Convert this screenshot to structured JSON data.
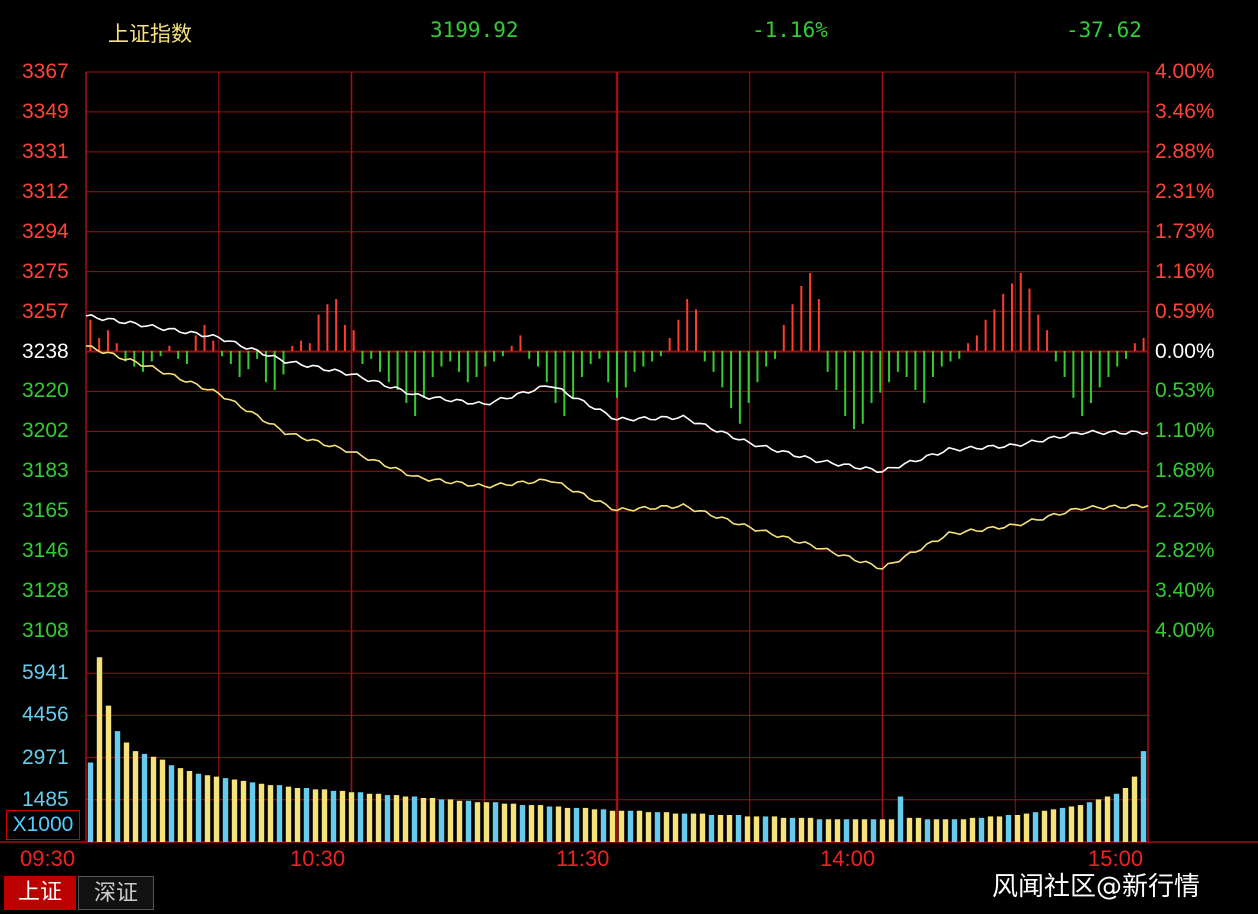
{
  "header": {
    "index_name": "上证指数",
    "last_price": "3199.92",
    "change_pct": "-1.16%",
    "change_pts": "-37.62"
  },
  "colors": {
    "up": "#ff3b30",
    "down": "#33cc33",
    "grid": "#a01010",
    "price_line": "#ffffff",
    "avg_line": "#f5e27a",
    "vol_a": "#f5e27a",
    "vol_b": "#66ccee"
  },
  "y_left_labels": [
    "3367",
    "3349",
    "3331",
    "3312",
    "3294",
    "3275",
    "3257",
    "3238",
    "3220",
    "3202",
    "3183",
    "3165",
    "3146",
    "3128",
    "3108"
  ],
  "y_right_labels": [
    "4.00%",
    "3.46%",
    "2.88%",
    "2.31%",
    "1.73%",
    "1.16%",
    "0.59%",
    "0.00%",
    "0.53%",
    "1.10%",
    "1.68%",
    "2.25%",
    "2.82%",
    "3.40%",
    "4.00%"
  ],
  "vol_labels": [
    "5941",
    "4456",
    "2971",
    "1485"
  ],
  "vol_unit": "X1000",
  "x_labels": [
    "09:30",
    "10:30",
    "11:30",
    "14:00",
    "15:00"
  ],
  "tabs": [
    {
      "label": "上证",
      "active": true
    },
    {
      "label": "深证",
      "active": false
    }
  ],
  "watermark": "风闻社区@新行情",
  "chart_data": {
    "type": "line",
    "x": [
      "09:30",
      "09:45",
      "10:00",
      "10:15",
      "10:30",
      "10:45",
      "11:00",
      "11:15",
      "11:30",
      "13:15",
      "13:30",
      "13:45",
      "14:00",
      "14:15",
      "14:30",
      "14:45",
      "15:00"
    ],
    "prev_close": 3238,
    "ylim": [
      3108,
      3367
    ],
    "series": [
      {
        "values": [
          3254,
          3249,
          3244,
          3233,
          3227,
          3217,
          3213,
          3222,
          3206,
          3207,
          3195,
          3187,
          3182,
          3192,
          3194,
          3200,
          3199.92
        ]
      },
      {
        "values": [
          3240,
          3230,
          3218,
          3200,
          3191,
          3179,
          3175,
          3178,
          3164,
          3166,
          3156,
          3147,
          3137,
          3153,
          3157,
          3165,
          3166
        ]
      }
    ],
    "volume_ylim": [
      0,
      7426
    ],
    "volume_bars": [
      2800,
      6500,
      4800,
      3900,
      3500,
      3200,
      3100,
      3000,
      2900,
      2700,
      2600,
      2500,
      2400,
      2350,
      2300,
      2250,
      2200,
      2150,
      2100,
      2050,
      2000,
      2000,
      1950,
      1900,
      1900,
      1850,
      1850,
      1800,
      1800,
      1750,
      1750,
      1700,
      1700,
      1650,
      1650,
      1600,
      1600,
      1550,
      1550,
      1500,
      1500,
      1450,
      1450,
      1400,
      1400,
      1400,
      1350,
      1350,
      1300,
      1300,
      1300,
      1250,
      1250,
      1200,
      1200,
      1200,
      1150,
      1150,
      1100,
      1100,
      1100,
      1100,
      1050,
      1050,
      1050,
      1000,
      1000,
      1000,
      1000,
      950,
      950,
      950,
      950,
      900,
      900,
      900,
      900,
      850,
      850,
      850,
      850,
      800,
      800,
      800,
      800,
      800,
      800,
      800,
      800,
      800,
      1600,
      850,
      850,
      800,
      800,
      800,
      800,
      800,
      850,
      850,
      900,
      900,
      950,
      950,
      1000,
      1050,
      1100,
      1150,
      1200,
      1250,
      1300,
      1400,
      1500,
      1600,
      1700,
      1900,
      2300,
      3200
    ],
    "tick_bars": [
      12,
      5,
      8,
      3,
      -4,
      -6,
      -8,
      -4,
      -2,
      2,
      -3,
      -5,
      6,
      10,
      4,
      -2,
      -5,
      -10,
      -7,
      -3,
      -12,
      -15,
      -9,
      2,
      4,
      3,
      14,
      18,
      20,
      10,
      8,
      -5,
      -3,
      -8,
      -12,
      -15,
      -20,
      -25,
      -18,
      -10,
      -6,
      -4,
      -8,
      -12,
      -10,
      -6,
      -4,
      -2,
      2,
      6,
      -3,
      -6,
      -12,
      -20,
      -25,
      -18,
      -10,
      -5,
      -3,
      -12,
      -18,
      -14,
      -8,
      -6,
      -4,
      -2,
      5,
      12,
      20,
      16,
      -4,
      -8,
      -14,
      -22,
      -28,
      -20,
      -12,
      -6,
      -3,
      10,
      18,
      25,
      30,
      20,
      -8,
      -15,
      -25,
      -30,
      -28,
      -20,
      -16,
      -12,
      -8,
      -10,
      -15,
      -20,
      -10,
      -6,
      -4,
      -3,
      3,
      6,
      12,
      16,
      22,
      26,
      30,
      24,
      14,
      8,
      -4,
      -10,
      -18,
      -25,
      -20,
      -14,
      -10,
      -6,
      -3,
      3,
      5
    ]
  }
}
